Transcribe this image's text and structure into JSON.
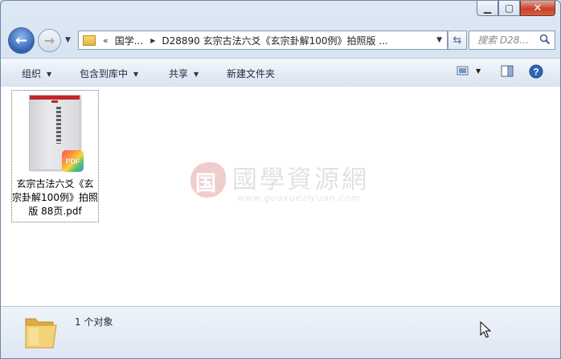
{
  "window": {
    "caption_buttons": [
      "minimize",
      "maximize",
      "close"
    ]
  },
  "nav": {
    "back_icon": "back-arrow-icon",
    "forward_icon": "forward-arrow-icon"
  },
  "address_bar": {
    "overflow_chevron": "«",
    "crumbs": [
      "国学...",
      "D28890 玄宗古法六爻《玄宗卦解100例》拍照版 ..."
    ]
  },
  "search": {
    "placeholder": "搜索 D28..."
  },
  "toolbar": {
    "organize": "组织",
    "include_in_library": "包含到库中",
    "share": "共享",
    "new_folder": "新建文件夹"
  },
  "files": [
    {
      "name": "玄宗古法六爻《玄宗卦解100例》拍照版 88页.pdf",
      "type_badge": "PDF"
    }
  ],
  "watermark": {
    "seal_char": "国",
    "title": "國學資源網",
    "url": "www.guoxueziyuan.com"
  },
  "details": {
    "count": "1 个对象"
  },
  "colors": {
    "pdf_badge": "#ff9d2f",
    "seal": "#e4a6a6",
    "accent_blue": "#2e62b5"
  }
}
